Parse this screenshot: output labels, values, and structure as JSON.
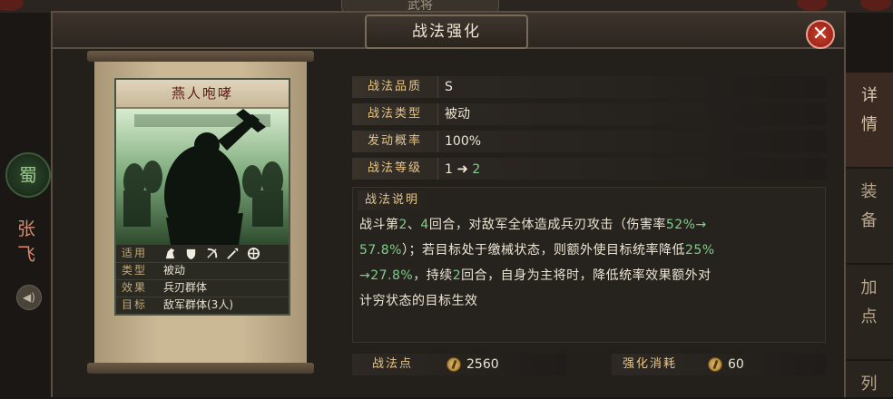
{
  "window": {
    "title": "战法强化",
    "top_tab": "武将",
    "close_symbol": "✕"
  },
  "side_panel": {
    "faction_glyph": "蜀",
    "general_name_chars": [
      "张",
      "飞"
    ],
    "speaker_symbol": "◀)"
  },
  "side_tabs": [
    {
      "chars": [
        "详",
        "情"
      ],
      "active": true
    },
    {
      "chars": [
        "装",
        "备"
      ],
      "active": false
    },
    {
      "chars": [
        "加",
        "点"
      ],
      "active": false
    },
    {
      "chars": [
        "列"
      ],
      "active": false
    }
  ],
  "card": {
    "title": "燕人咆哮",
    "info": {
      "applicable": {
        "label": "适用",
        "icons": [
          "cavalry-icon",
          "shield-icon",
          "bow-icon",
          "spear-icon",
          "siege-icon"
        ]
      },
      "type": {
        "label": "类型",
        "value": "被动"
      },
      "effect": {
        "label": "效果",
        "value": "兵刃群体"
      },
      "target": {
        "label": "目标",
        "value": "敌军群体(3人)"
      }
    }
  },
  "stats": {
    "quality": {
      "label": "战法品质",
      "value": "S"
    },
    "type": {
      "label": "战法类型",
      "value": "被动"
    },
    "trigger_rate": {
      "label": "发动概率",
      "value": "100%"
    },
    "level": {
      "label": "战法等级",
      "from": "1",
      "arrow": "➜",
      "to": "2"
    }
  },
  "description": {
    "title": "战法说明",
    "lines": [
      [
        {
          "t": "战斗第",
          "g": false
        },
        {
          "t": "2",
          "g": true
        },
        {
          "t": "、",
          "g": false
        },
        {
          "t": "4",
          "g": true
        },
        {
          "t": "回合，对敌军全体造成兵刃攻击（伤害率",
          "g": false
        },
        {
          "t": "52%→",
          "g": true
        }
      ],
      [
        {
          "t": "57.8%",
          "g": true
        },
        {
          "t": "）；若目标处于缴械状态，则额外使目标统率降低",
          "g": false
        },
        {
          "t": "25%",
          "g": true
        }
      ],
      [
        {
          "t": "→27.8%",
          "g": true
        },
        {
          "t": "，持续",
          "g": false
        },
        {
          "t": "2",
          "g": true
        },
        {
          "t": "回合，自身为主将时，降低统率效果额外对",
          "g": false
        }
      ],
      [
        {
          "t": "计穷状态的目标生效",
          "g": false
        }
      ]
    ]
  },
  "footer": {
    "tactic_points": {
      "label": "战法点",
      "value": "2560",
      "icon": "tactic-coin-icon"
    },
    "enhance_cost": {
      "label": "强化消耗",
      "value": "60",
      "icon": "tactic-coin-icon"
    }
  },
  "colors": {
    "highlight_green": "#7fcf8a",
    "label_gold": "#e6c68a",
    "close_red": "#c0392b"
  }
}
